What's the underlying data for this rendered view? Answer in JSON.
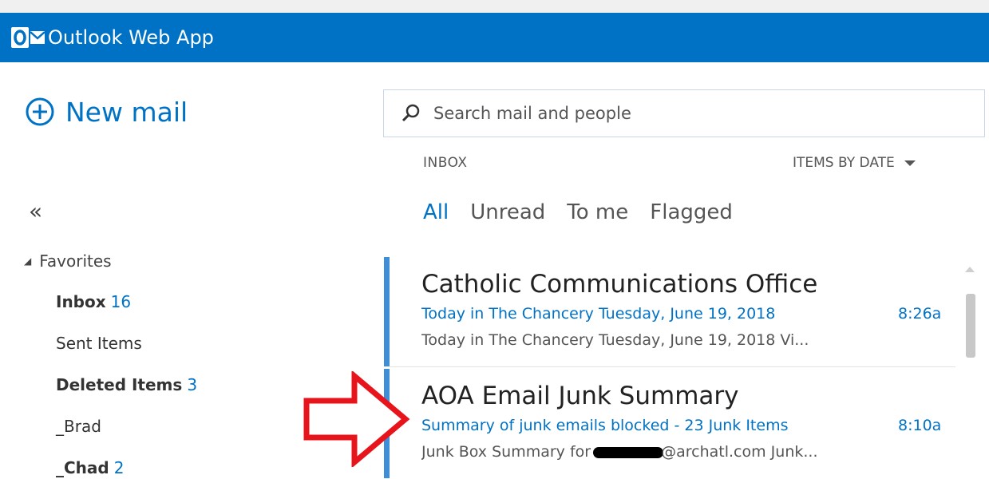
{
  "header": {
    "app_title": "Outlook Web App",
    "logo_icon": "outlook-logo-icon",
    "color": "#0072c6"
  },
  "sidebar": {
    "new_mail_label": "New mail",
    "collapse_glyph": "«",
    "favorites_label": "Favorites",
    "folders": [
      {
        "label": "Inbox",
        "count": "16",
        "bold": true
      },
      {
        "label": "Sent Items",
        "count": "",
        "bold": false
      },
      {
        "label": "Deleted Items",
        "count": "3",
        "bold": true
      },
      {
        "label": "_Brad",
        "count": "",
        "bold": false
      },
      {
        "label": "_Chad",
        "count": "2",
        "bold": true
      }
    ]
  },
  "search": {
    "placeholder": "Search mail and people"
  },
  "list": {
    "folder_label": "INBOX",
    "sort_label": "ITEMS BY DATE",
    "filters": [
      "All",
      "Unread",
      "To me",
      "Flagged"
    ],
    "active_filter": "All",
    "messages": [
      {
        "sender": "Catholic Communications Office",
        "subject": "Today in The Chancery Tuesday, June 19, 2018",
        "time": "8:26a",
        "preview": "Today in The Chancery Tuesday, June 19, 2018   Vi..."
      },
      {
        "sender": "AOA Email Junk Summary",
        "subject": "Summary of junk emails blocked - 23 Junk Items",
        "time": "8:10a",
        "preview_before": "Junk Box Summary for",
        "preview_after": "@archatl.com   Junk..."
      }
    ]
  },
  "colors": {
    "accent": "#0072c6",
    "unread_bar": "#3f8fd8",
    "annotation_arrow": "#e8141c"
  }
}
